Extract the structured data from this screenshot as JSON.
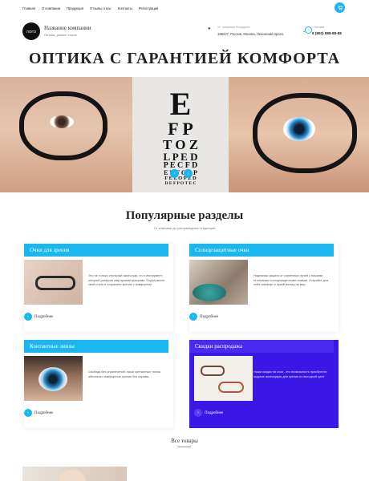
{
  "nav": {
    "items": [
      "Главная",
      "О компании",
      "Продукция",
      "Отзывы о нас",
      "Контакты",
      "Регистрация"
    ],
    "cart_icon": "cart-icon"
  },
  "header": {
    "logo": "ЛОГО",
    "company_name": "Название компании",
    "tagline": "Оптика, ремонт очков",
    "address_label": "Ул. напрямик безадреса",
    "address": "198247, Россия, Москва, Ленинский просп.",
    "phone_label": "г. Москва",
    "phone": "8 (800) 888-88-88"
  },
  "title": "ОПТИКА С ГАРАНТИЕЙ КОМФОРТА",
  "hero": {
    "chart_rows": [
      "E",
      "F P",
      "T O Z",
      "L P E D",
      "P E C F D",
      "E D F C Z P",
      "F E L O P Z D",
      "D E F P O T E C"
    ],
    "nav_prev": "‹",
    "nav_next": "›"
  },
  "section": {
    "title": "Популярные разделы",
    "subtitle": "От классики до ультрамодных тенденций"
  },
  "cards": [
    {
      "title": "Очки для зрения",
      "text": "Это не только стильный аксессуар, но и инструмент, который раскроет мир яркими красками. Подчеркните свой стиль и сохраните зрение с комфортом",
      "more": "Подробнее"
    },
    {
      "title": "Солнцезащитные очки",
      "text": "Надежная защита от солнечных лучей с нашими стильными солнцезащитными очками. Откройте для себя комфорт и яркий взгляд на мир.",
      "more": "Подробнее"
    },
    {
      "title": "Контактные линзы",
      "text": "Свобода без ограничений: наши контактные линзы обеспечат комфортное зрение без оправы.",
      "more": "Подробнее"
    },
    {
      "title": "Скидки распродажа",
      "text": "Наши скидки на очки - это возможность приобрести модные аксессуары для зрения по выгодной цене",
      "more": "Подробнее"
    }
  ],
  "all_products": "Все товары",
  "colors": {
    "accent": "#19b6f0",
    "sale": "#3a17e6"
  }
}
